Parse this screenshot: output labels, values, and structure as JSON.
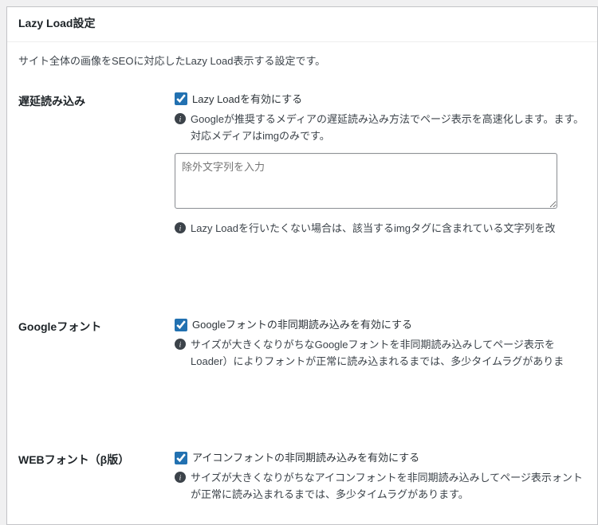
{
  "panel": {
    "title": "Lazy Load設定",
    "description": "サイト全体の画像をSEOに対応したLazy Load表示する設定です。"
  },
  "rows": {
    "lazyload": {
      "heading": "遅延読み込み",
      "checkbox_label": "Lazy Loadを有効にする",
      "checked": true,
      "hint1": "Googleが推奨するメディアの遅延読み込み方法でページ表示を高速化します。ます。対応メディアはimgのみです。",
      "textarea_value": "",
      "textarea_placeholder": "除外文字列を入力",
      "hint2": "Lazy Loadを行いたくない場合は、該当するimgタグに含まれている文字列を改"
    },
    "googlefont": {
      "heading": "Googleフォント",
      "checkbox_label": "Googleフォントの非同期読み込みを有効にする",
      "checked": true,
      "hint": "サイズが大きくなりがちなGoogleフォントを非同期読み込みしてページ表示をLoader）によりフォントが正常に読み込まれるまでは、多少タイムラグがありま"
    },
    "webfont": {
      "heading": "WEBフォント（β版）",
      "checkbox_label": "アイコンフォントの非同期読み込みを有効にする",
      "checked": true,
      "hint": "サイズが大きくなりがちなアイコンフォントを非同期読み込みしてページ表示ォントが正常に読み込まれるまでは、多少タイムラグがあります。"
    }
  }
}
